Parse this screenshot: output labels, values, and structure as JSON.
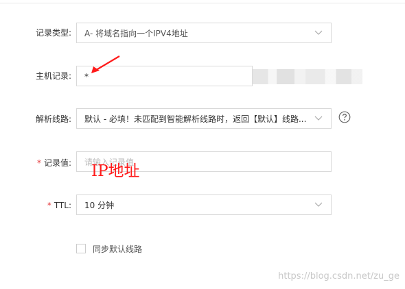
{
  "form": {
    "record_type": {
      "label": "记录类型:",
      "value": "A- 将域名指向一个IPV4地址"
    },
    "host": {
      "label": "主机记录:",
      "value": "*"
    },
    "line": {
      "label": "解析线路:",
      "value": "默认 - 必填！未匹配到智能解析线路时，返回【默认】线路..."
    },
    "record_value": {
      "required_mark": "*",
      "label": "记录值:",
      "placeholder": "请输入记录值"
    },
    "ttl": {
      "required_mark": "*",
      "label": "TTL:",
      "value": "10 分钟"
    },
    "sync_default": {
      "label": "同步默认线路",
      "checked": false
    }
  },
  "annotation": {
    "text": "IP地址",
    "color": "#ff1a1a"
  },
  "watermark": "https://blog.csdn.net/zu_ge",
  "icons": {
    "dropdown": "chevron-down-icon",
    "help": "question-circle-icon",
    "pointer": "red-arrow-icon"
  },
  "colors": {
    "required": "#e4393c",
    "border": "#d9d9d9",
    "annotation": "#ff1a1a"
  }
}
